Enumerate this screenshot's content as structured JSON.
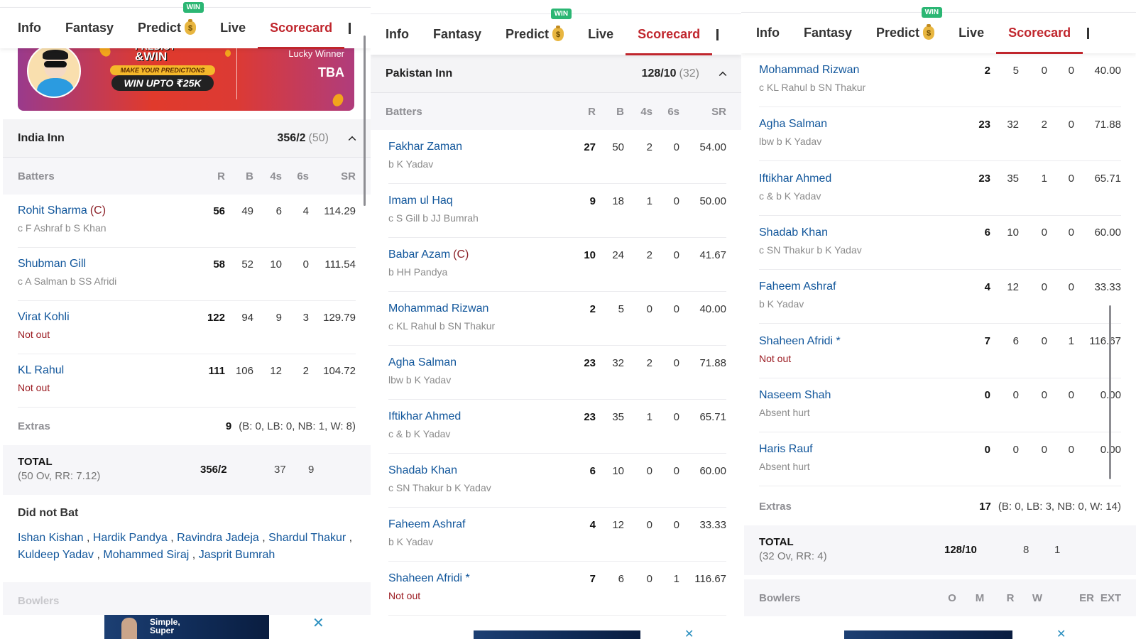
{
  "tabs": [
    {
      "label": "Info",
      "active": false
    },
    {
      "label": "Fantasy",
      "active": false
    },
    {
      "label": "Predict",
      "active": false,
      "badge": "WIN",
      "icon": "money-bag-icon"
    },
    {
      "label": "Live",
      "active": false
    },
    {
      "label": "Scorecard",
      "active": true
    }
  ],
  "colors": {
    "accent": "#c0262d",
    "link": "#11569b",
    "not_out": "#9b1c22",
    "win_badge": "#2bb673"
  },
  "banner": {
    "title_line1": "PREDICT",
    "title_line2": "&WIN",
    "tagline": "MAKE YOUR PREDICTIONS",
    "prize": "WIN UPTO ₹25K",
    "lucky_label": "Lucky Winner",
    "lucky_value": "TBA"
  },
  "batting_columns": {
    "label": "Batters",
    "r": "R",
    "b": "B",
    "fours": "4s",
    "sixes": "6s",
    "sr": "SR"
  },
  "bowling_columns": {
    "label": "Bowlers",
    "o": "O",
    "m": "M",
    "r": "R",
    "w": "W",
    "er": "ER",
    "ext": "EXT"
  },
  "india": {
    "title": "India Inn",
    "score": "356/2",
    "overs": "(50)",
    "batters": [
      {
        "name": "Rohit Sharma",
        "captain": "(C)",
        "dismissal": "c F Ashraf b S Khan",
        "not_out": false,
        "r": "56",
        "b": "49",
        "fours": "6",
        "sixes": "4",
        "sr": "114.29"
      },
      {
        "name": "Shubman Gill",
        "captain": "",
        "dismissal": "c A Salman b SS Afridi",
        "not_out": false,
        "r": "58",
        "b": "52",
        "fours": "10",
        "sixes": "0",
        "sr": "111.54"
      },
      {
        "name": "Virat Kohli",
        "captain": "",
        "dismissal": "Not out",
        "not_out": true,
        "r": "122",
        "b": "94",
        "fours": "9",
        "sixes": "3",
        "sr": "129.79"
      },
      {
        "name": "KL Rahul",
        "captain": "",
        "dismissal": "Not out",
        "not_out": true,
        "r": "111",
        "b": "106",
        "fours": "12",
        "sixes": "2",
        "sr": "104.72"
      }
    ],
    "extras": {
      "label": "Extras",
      "value": "9",
      "detail": "(B: 0, LB: 0, NB: 1, W: 8)"
    },
    "total": {
      "label": "TOTAL",
      "detail": "(50 Ov, RR: 7.12)",
      "score": "356/2",
      "fours": "37",
      "sixes": "9"
    },
    "did_not_bat": {
      "title": "Did not Bat",
      "players": [
        "Ishan Kishan",
        "Hardik Pandya",
        "Ravindra Jadeja",
        "Shardul Thakur",
        "Kuldeep Yadav",
        "Mohammed Siraj",
        "Jasprit Bumrah"
      ]
    }
  },
  "pakistan": {
    "title": "Pakistan Inn",
    "score": "128/10",
    "overs": "(32)",
    "batters": [
      {
        "name": "Fakhar Zaman",
        "captain": "",
        "dismissal": "b K Yadav",
        "not_out": false,
        "r": "27",
        "b": "50",
        "fours": "2",
        "sixes": "0",
        "sr": "54.00"
      },
      {
        "name": "Imam ul Haq",
        "captain": "",
        "dismissal": "c S Gill b JJ Bumrah",
        "not_out": false,
        "r": "9",
        "b": "18",
        "fours": "1",
        "sixes": "0",
        "sr": "50.00"
      },
      {
        "name": "Babar Azam",
        "captain": "(C)",
        "dismissal": "b HH Pandya",
        "not_out": false,
        "r": "10",
        "b": "24",
        "fours": "2",
        "sixes": "0",
        "sr": "41.67"
      },
      {
        "name": "Mohammad Rizwan",
        "captain": "",
        "dismissal": "c KL Rahul b SN Thakur",
        "not_out": false,
        "r": "2",
        "b": "5",
        "fours": "0",
        "sixes": "0",
        "sr": "40.00"
      },
      {
        "name": "Agha Salman",
        "captain": "",
        "dismissal": "lbw b K Yadav",
        "not_out": false,
        "r": "23",
        "b": "32",
        "fours": "2",
        "sixes": "0",
        "sr": "71.88"
      },
      {
        "name": "Iftikhar Ahmed",
        "captain": "",
        "dismissal": "c & b K Yadav",
        "not_out": false,
        "r": "23",
        "b": "35",
        "fours": "1",
        "sixes": "0",
        "sr": "65.71"
      },
      {
        "name": "Shadab Khan",
        "captain": "",
        "dismissal": "c SN Thakur b K Yadav",
        "not_out": false,
        "r": "6",
        "b": "10",
        "fours": "0",
        "sixes": "0",
        "sr": "60.00"
      },
      {
        "name": "Faheem Ashraf",
        "captain": "",
        "dismissal": "b K Yadav",
        "not_out": false,
        "r": "4",
        "b": "12",
        "fours": "0",
        "sixes": "0",
        "sr": "33.33"
      },
      {
        "name": "Shaheen Afridi *",
        "captain": "",
        "dismissal": "Not out",
        "not_out": true,
        "r": "7",
        "b": "6",
        "fours": "0",
        "sixes": "1",
        "sr": "116.67"
      },
      {
        "name": "Naseem Shah",
        "captain": "",
        "dismissal": "Absent hurt",
        "not_out": false,
        "r": "0",
        "b": "0",
        "fours": "0",
        "sixes": "0",
        "sr": "0.00"
      },
      {
        "name": "Haris Rauf",
        "captain": "",
        "dismissal": "Absent hurt",
        "not_out": false,
        "r": "0",
        "b": "0",
        "fours": "0",
        "sixes": "0",
        "sr": "0.00"
      }
    ],
    "extras": {
      "label": "Extras",
      "value": "17",
      "detail": "(B: 0, LB: 3, NB: 0, W: 14)"
    },
    "total": {
      "label": "TOTAL",
      "detail": "(32 Ov, RR: 4)",
      "score": "128/10",
      "fours": "8",
      "sixes": "1"
    }
  },
  "ads": {
    "text_line1": "Simple,",
    "text_line2": "Super",
    "close": "✕"
  }
}
